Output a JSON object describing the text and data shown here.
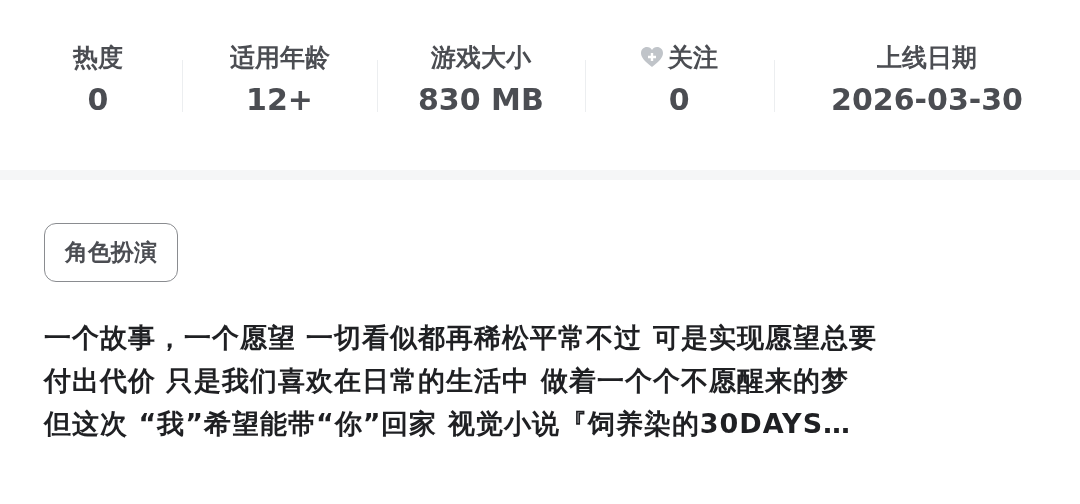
{
  "stats": [
    {
      "label": "热度",
      "value": "0",
      "kind": "plain"
    },
    {
      "label": "适用年龄",
      "value": "12+",
      "kind": "plain"
    },
    {
      "label": "游戏大小",
      "value": "830  MB",
      "kind": "plain"
    },
    {
      "label": "关注",
      "value": "0",
      "kind": "follow"
    },
    {
      "label": "上线日期",
      "value": "2026-03-30",
      "kind": "plain"
    }
  ],
  "tags": [
    "角色扮演"
  ],
  "description_lines": [
    "一个故事，一个愿望 一切看似都再稀松平常不过 可是实现愿望总要",
    "付出代价 只是我们喜欢在日常的生活中 做着一个个不愿醒来的梦",
    "但这次 “我”希望能带“你”回家 视觉小说『饲养染的30DAYS…"
  ]
}
